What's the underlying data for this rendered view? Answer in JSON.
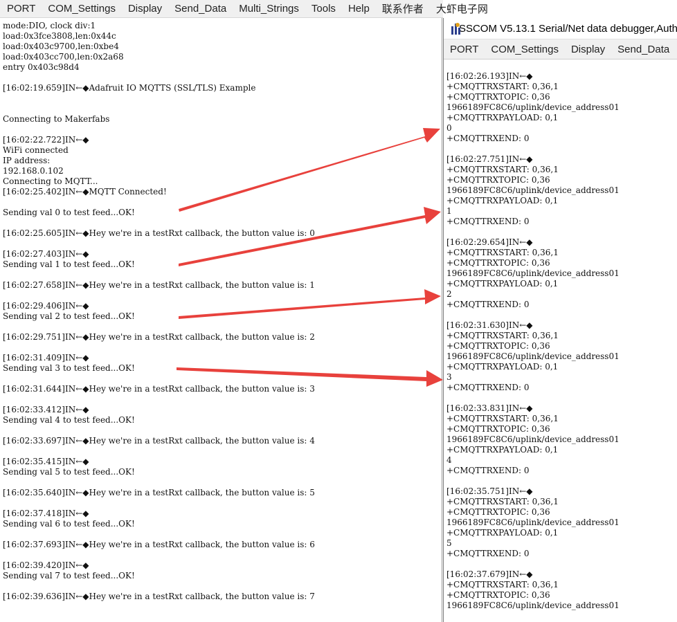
{
  "menu_left": [
    "PORT",
    "COM_Settings",
    "Display",
    "Send_Data",
    "Multi_Strings",
    "Tools",
    "Help",
    "联系作者",
    "大虾电子网"
  ],
  "right_window": {
    "title": "SSCOM V5.13.1 Serial/Net data debugger,Auth",
    "menu": [
      "PORT",
      "COM_Settings",
      "Display",
      "Send_Data"
    ]
  },
  "left_log": [
    "mode:DIO, clock div:1",
    "load:0x3fce3808,len:0x44c",
    "load:0x403c9700,len:0xbe4",
    "load:0x403cc700,len:0x2a68",
    "entry 0x403c98d4",
    "",
    "[16:02:19.659]IN←◆Adafruit IO MQTTS (SSL/TLS) Example",
    "",
    "",
    "Connecting to Makerfabs",
    "",
    "[16:02:22.722]IN←◆",
    "WiFi connected",
    "IP address:",
    "192.168.0.102",
    "Connecting to MQTT...",
    "[16:02:25.402]IN←◆MQTT Connected!",
    "",
    "Sending val 0 to test feed...OK!",
    "",
    "[16:02:25.605]IN←◆Hey we're in a testRxt callback, the button value is: 0",
    "",
    "[16:02:27.403]IN←◆",
    "Sending val 1 to test feed...OK!",
    "",
    "[16:02:27.658]IN←◆Hey we're in a testRxt callback, the button value is: 1",
    "",
    "[16:02:29.406]IN←◆",
    "Sending val 2 to test feed...OK!",
    "",
    "[16:02:29.751]IN←◆Hey we're in a testRxt callback, the button value is: 2",
    "",
    "[16:02:31.409]IN←◆",
    "Sending val 3 to test feed...OK!",
    "",
    "[16:02:31.644]IN←◆Hey we're in a testRxt callback, the button value is: 3",
    "",
    "[16:02:33.412]IN←◆",
    "Sending val 4 to test feed...OK!",
    "",
    "[16:02:33.697]IN←◆Hey we're in a testRxt callback, the button value is: 4",
    "",
    "[16:02:35.415]IN←◆",
    "Sending val 5 to test feed...OK!",
    "",
    "[16:02:35.640]IN←◆Hey we're in a testRxt callback, the button value is: 5",
    "",
    "[16:02:37.418]IN←◆",
    "Sending val 6 to test feed...OK!",
    "",
    "[16:02:37.693]IN←◆Hey we're in a testRxt callback, the button value is: 6",
    "",
    "[16:02:39.420]IN←◆",
    "Sending val 7 to test feed...OK!",
    "",
    "[16:02:39.636]IN←◆Hey we're in a testRxt callback, the button value is: 7"
  ],
  "right_log": [
    "[16:02:26.193]IN←◆",
    "+CMQTTRXSTART: 0,36,1",
    "+CMQTTRXTOPIC: 0,36",
    "1966189FC8C6/uplink/device_address01",
    "+CMQTTRXPAYLOAD: 0,1",
    "0",
    "+CMQTTRXEND: 0",
    "",
    "[16:02:27.751]IN←◆",
    "+CMQTTRXSTART: 0,36,1",
    "+CMQTTRXTOPIC: 0,36",
    "1966189FC8C6/uplink/device_address01",
    "+CMQTTRXPAYLOAD: 0,1",
    "1",
    "+CMQTTRXEND: 0",
    "",
    "[16:02:29.654]IN←◆",
    "+CMQTTRXSTART: 0,36,1",
    "+CMQTTRXTOPIC: 0,36",
    "1966189FC8C6/uplink/device_address01",
    "+CMQTTRXPAYLOAD: 0,1",
    "2",
    "+CMQTTRXEND: 0",
    "",
    "[16:02:31.630]IN←◆",
    "+CMQTTRXSTART: 0,36,1",
    "+CMQTTRXTOPIC: 0,36",
    "1966189FC8C6/uplink/device_address01",
    "+CMQTTRXPAYLOAD: 0,1",
    "3",
    "+CMQTTRXEND: 0",
    "",
    "[16:02:33.831]IN←◆",
    "+CMQTTRXSTART: 0,36,1",
    "+CMQTTRXTOPIC: 0,36",
    "1966189FC8C6/uplink/device_address01",
    "+CMQTTRXPAYLOAD: 0,1",
    "4",
    "+CMQTTRXEND: 0",
    "",
    "[16:02:35.751]IN←◆",
    "+CMQTTRXSTART: 0,36,1",
    "+CMQTTRXTOPIC: 0,36",
    "1966189FC8C6/uplink/device_address01",
    "+CMQTTRXPAYLOAD: 0,1",
    "5",
    "+CMQTTRXEND: 0",
    "",
    "[16:02:37.679]IN←◆",
    "+CMQTTRXSTART: 0,36,1",
    "+CMQTTRXTOPIC: 0,36",
    "1966189FC8C6/uplink/device_address01"
  ],
  "colors": {
    "arrow": "#e8413c"
  },
  "icons": {
    "app": "sscom-app-icon",
    "arrows": "annotation-arrow"
  }
}
